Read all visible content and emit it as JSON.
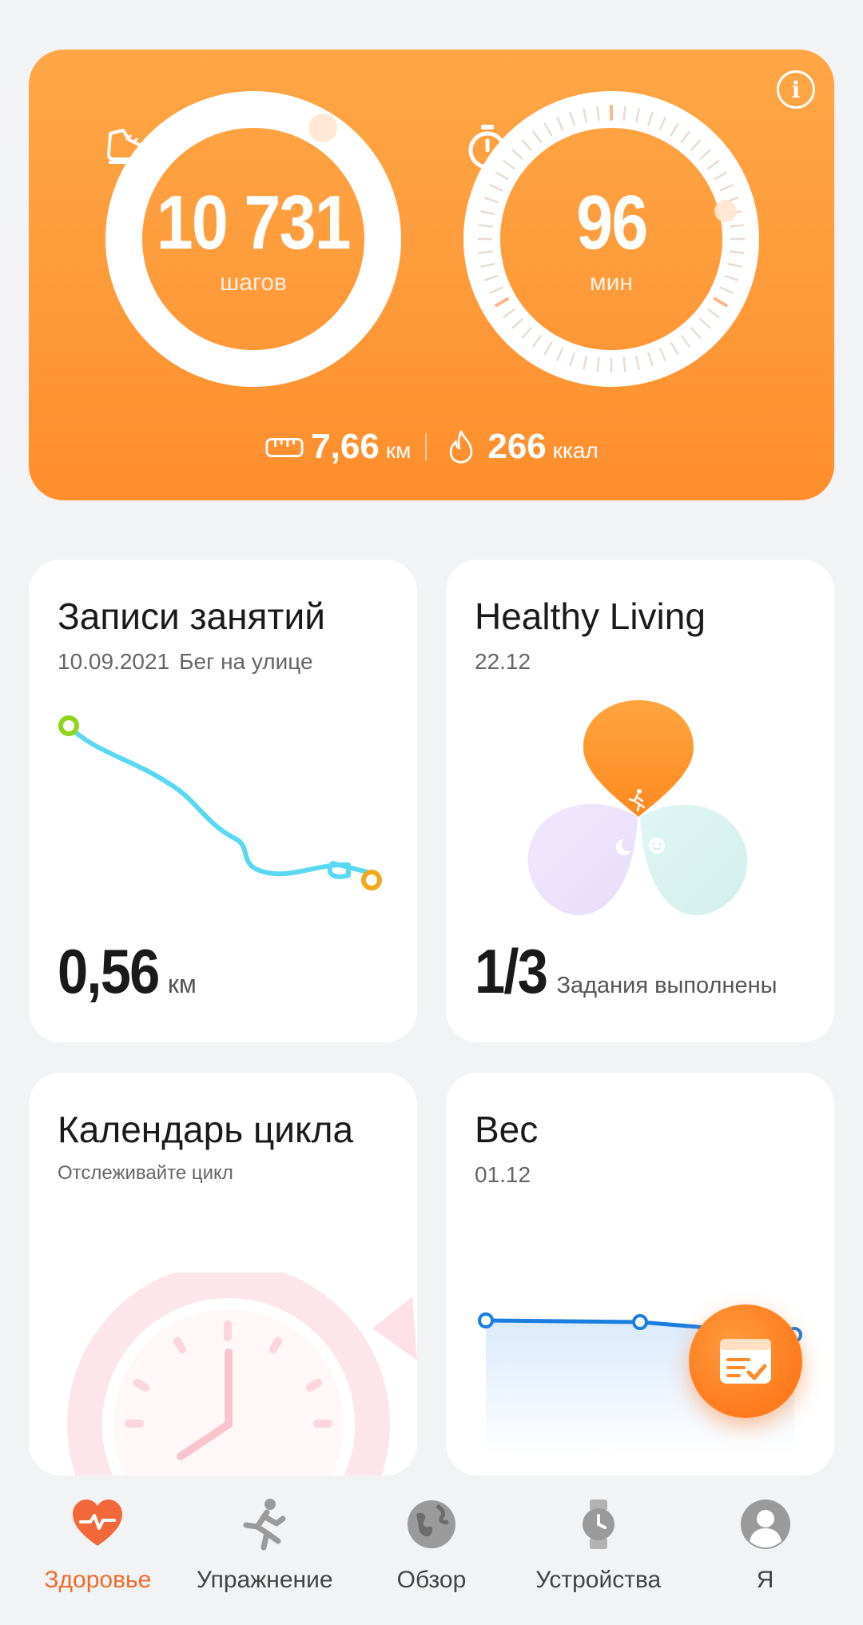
{
  "activity": {
    "steps_value": "10 731",
    "steps_unit": "шагов",
    "steps_progress": 0.99,
    "minutes_value": "96",
    "minutes_unit": "мин",
    "minutes_progress": 1.0,
    "distance_value": "7,66",
    "distance_unit": "км",
    "calories_value": "266",
    "calories_unit": "ккал"
  },
  "cards": {
    "workouts": {
      "title": "Записи занятий",
      "date": "10.09.2021",
      "type": "Бег на улице",
      "value": "0,56",
      "unit": "км"
    },
    "healthy_living": {
      "title": "Healthy Living",
      "date": "22.12",
      "value": "1/3",
      "caption": "Задания выполнены"
    },
    "cycle": {
      "title": "Календарь цикла",
      "subtitle": "Отслеживайте цикл"
    },
    "weight": {
      "title": "Вес",
      "date": "01.12"
    }
  },
  "nav": {
    "items": [
      {
        "label": "Здоровье",
        "icon": "heart-pulse-icon",
        "active": true
      },
      {
        "label": "Упражнение",
        "icon": "running-person-icon",
        "active": false
      },
      {
        "label": "Обзор",
        "icon": "globe-icon",
        "active": false
      },
      {
        "label": "Устройства",
        "icon": "watch-icon",
        "active": false
      },
      {
        "label": "Я",
        "icon": "profile-icon",
        "active": false
      }
    ]
  },
  "colors": {
    "accent": "#ff9a3a",
    "active_nav": "#f26a2a",
    "route": "#5ad8f2",
    "weight_line": "#1a7de0"
  }
}
